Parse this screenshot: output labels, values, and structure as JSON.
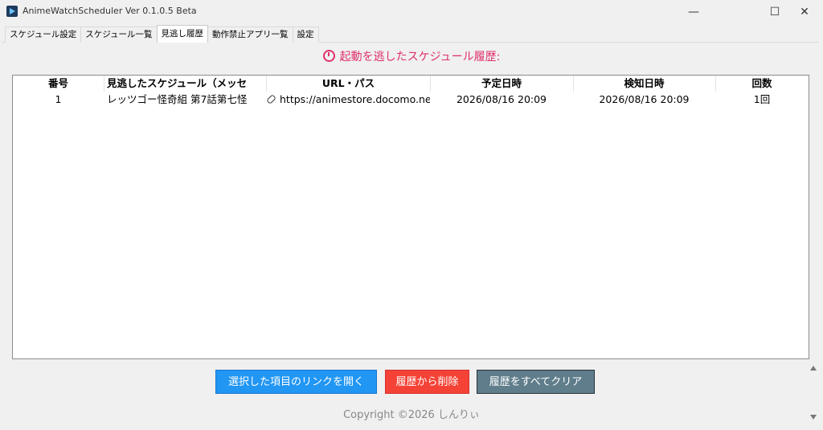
{
  "window": {
    "title": "AnimeWatchScheduler Ver 0.1.0.5 Beta",
    "minimize": "—",
    "maximize": "☐",
    "close": "✕"
  },
  "tabs": [
    {
      "label": "スケジュール設定",
      "active": false
    },
    {
      "label": "スケジュール一覧",
      "active": false
    },
    {
      "label": "見逃し履歴",
      "active": true
    },
    {
      "label": "動作禁止アプリ一覧",
      "active": false
    },
    {
      "label": "設定",
      "active": false
    }
  ],
  "heading": {
    "icon": "alarm-clock-icon",
    "text": "起動を逃したスケジュール履歴:",
    "color": "#e0306a"
  },
  "table": {
    "columns": [
      "番号",
      "見逃したスケジュール（メッセ",
      "URL・パス",
      "予定日時",
      "検知日時",
      "回数"
    ],
    "rows": [
      {
        "num": "1",
        "schedule": "レッツゴー怪奇組 第7話第七怪",
        "url": "https://animestore.docomo.ne.jp",
        "scheduled": "2026/08/16 20:09",
        "detected": "2026/08/16 20:09",
        "count": "1回"
      }
    ]
  },
  "buttons": {
    "open_link": "選択した項目のリンクを開く",
    "delete": "履歴から削除",
    "clear_all": "履歴をすべてクリア"
  },
  "colors": {
    "open": "#2196f3",
    "delete": "#f44336",
    "clear": "#607d8b"
  },
  "footer": {
    "copyright": "Copyright ©2026 しんりぃ"
  }
}
